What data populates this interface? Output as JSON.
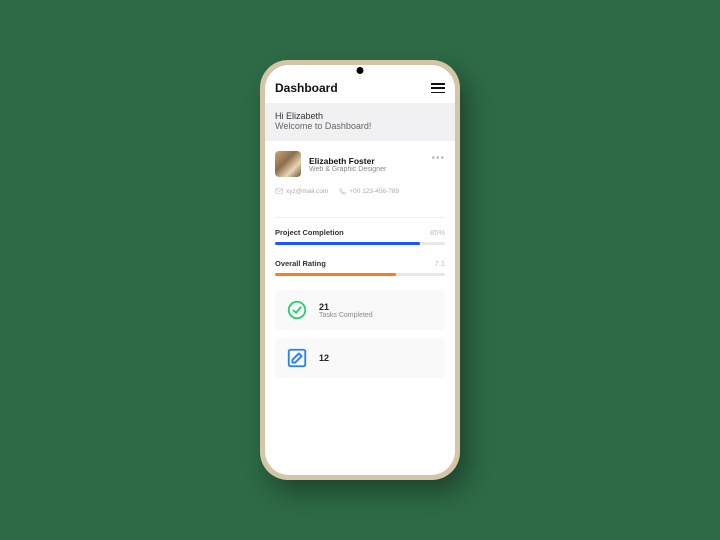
{
  "header": {
    "title": "Dashboard"
  },
  "greeting": {
    "hi": "Hi Elizabeth",
    "welcome": "Welcome to Dashboard!"
  },
  "profile": {
    "name": "Elizabeth Foster",
    "role": "Web & Graphic Designer",
    "email": "xyz@mail.com",
    "phone": "+00 123-456-789"
  },
  "progress": [
    {
      "label": "Project Completion",
      "value_text": "85%",
      "value": 85,
      "color": "#1a56ff"
    },
    {
      "label": "Overall Rating",
      "value_text": "7.1",
      "value": 71,
      "color": "#ff7a1a"
    }
  ],
  "stats": [
    {
      "number": "21",
      "label": "Tasks Completed",
      "icon": "checkmark-circle",
      "icon_color": "#2ecc71"
    },
    {
      "number": "12",
      "label": "",
      "icon": "edit-square",
      "icon_color": "#2980ef"
    }
  ]
}
